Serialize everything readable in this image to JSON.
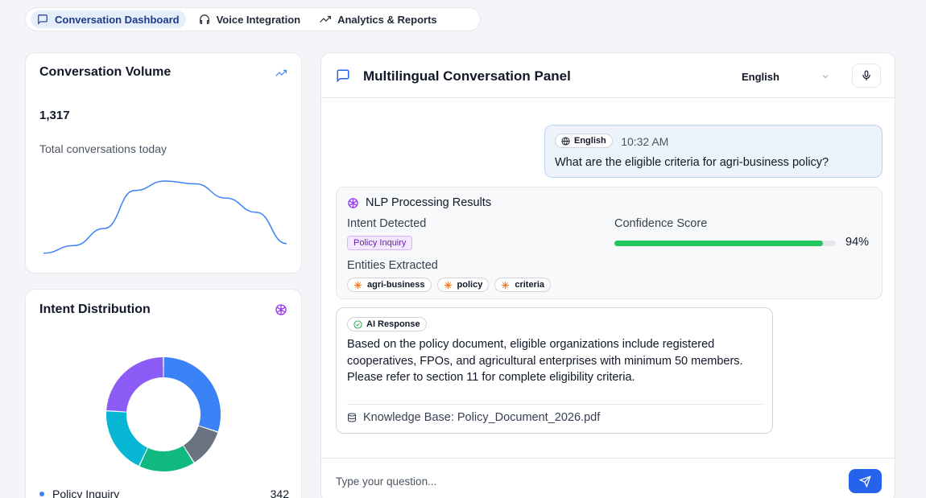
{
  "tabs": [
    {
      "label": "Conversation Dashboard",
      "icon": "message-square-icon",
      "active": true
    },
    {
      "label": "Voice Integration",
      "icon": "headphones-icon",
      "active": false
    },
    {
      "label": "Analytics & Reports",
      "icon": "trending-up-icon",
      "active": false
    }
  ],
  "volume": {
    "title": "Conversation Volume",
    "count": "1,317",
    "subtitle": "Total conversations today",
    "trend": [
      2,
      10,
      28,
      68,
      78,
      75,
      60,
      45,
      12
    ]
  },
  "intent": {
    "title": "Intent Distribution",
    "segments": [
      {
        "color": "#3b82f6",
        "share": 0.3
      },
      {
        "color": "#6b7280",
        "share": 0.11
      },
      {
        "color": "#10b981",
        "share": 0.16
      },
      {
        "color": "#06b6d4",
        "share": 0.19
      },
      {
        "color": "#8b5cf6",
        "share": 0.24
      }
    ],
    "legend": [
      {
        "label": "Policy Inquiry",
        "count": "342",
        "color": "#3b82f6"
      }
    ]
  },
  "panel": {
    "title": "Multilingual Conversation Panel",
    "language": "English",
    "user_message": {
      "language_chip": "English",
      "time": "10:32 AM",
      "text": "What are the eligible criteria for agri-business policy?"
    },
    "nlp": {
      "title": "NLP Processing Results",
      "intent_label": "Intent Detected",
      "intent_value": "Policy Inquiry",
      "confidence_label": "Confidence Score",
      "confidence": 0.94,
      "confidence_text": "94%",
      "entities_label": "Entities Extracted",
      "entities": [
        "agri-business",
        "policy",
        "criteria"
      ]
    },
    "ai": {
      "chip": "AI Response",
      "text": "Based on the policy document, eligible organizations include registered cooperatives, FPOs, and agricultural enterprises with minimum 50 members. Please refer to section 11 for complete eligibility criteria.",
      "source": "Knowledge Base: Policy_Document_2026.pdf"
    },
    "input_placeholder": "Type your question..."
  },
  "colors": {
    "accent": "#2563eb",
    "success": "#22c55e",
    "intent_badge": "#f3e8ff"
  }
}
